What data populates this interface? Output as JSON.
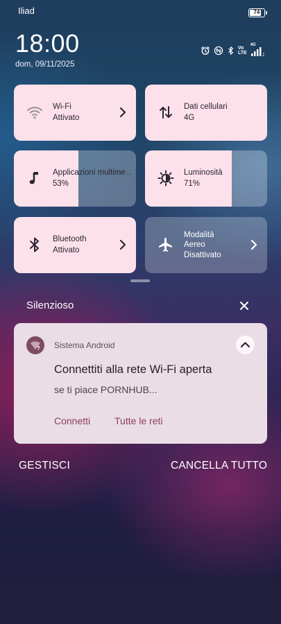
{
  "status_bar": {
    "carrier": "Iliad",
    "battery_level": "74",
    "volte_label": "Vo\nLTE",
    "network_type": "4G"
  },
  "header": {
    "time": "18:00",
    "date": "dom, 09/11/2025"
  },
  "quick_settings": {
    "wifi": {
      "title": "Wi-Fi",
      "status": "Attivato"
    },
    "mobile_data": {
      "title": "Dati cellulari",
      "status": "4G"
    },
    "media": {
      "title": "Applicazioni multime…",
      "value": "53%",
      "level": 0.53
    },
    "brightness": {
      "title": "Luminosità",
      "value": "71%",
      "level": 0.71
    },
    "bluetooth": {
      "title": "Bluetooth",
      "status": "Attivato"
    },
    "airplane": {
      "title": "Modalità\nAereo",
      "status": "Disattivato"
    }
  },
  "notifications": {
    "section_title": "Silenzioso",
    "items": [
      {
        "app_name": "Sistema Android",
        "title": "Connettiti alla rete Wi-Fi aperta",
        "text": "se ti piace PORNHUB...",
        "actions": [
          "Connetti",
          "Tutte le reti"
        ]
      }
    ]
  },
  "footer": {
    "manage_label": "GESTISCI",
    "clear_all_label": "CANCELLA TUTTO"
  },
  "colors": {
    "tile_active": "#fce1eb",
    "notification_bg": "#eadde6",
    "action_accent": "#8c3f5c"
  }
}
